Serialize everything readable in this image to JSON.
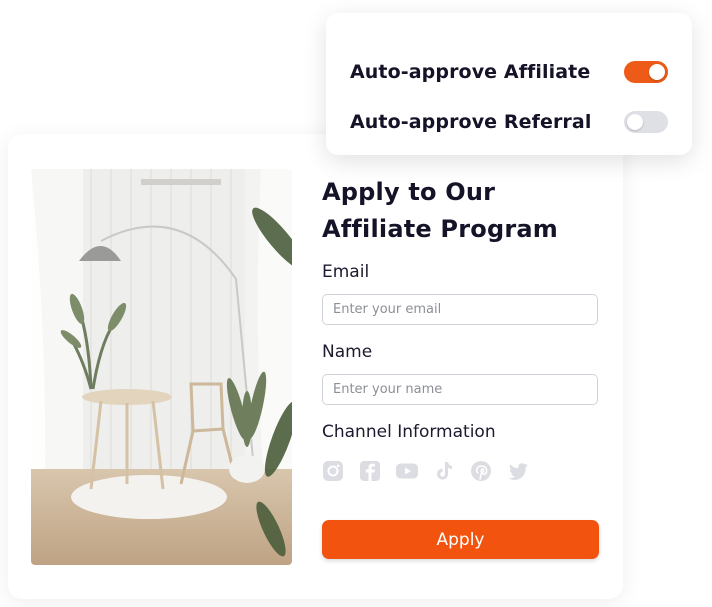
{
  "settings": {
    "auto_approve_affiliate": {
      "label": "Auto-approve Affiliate",
      "enabled": true
    },
    "auto_approve_referral": {
      "label": "Auto-approve Referral",
      "enabled": false
    }
  },
  "form": {
    "title": "Apply to Our Affiliate Program",
    "email_label": "Email",
    "email_placeholder": "Enter your email",
    "name_label": "Name",
    "name_placeholder": "Enter your name",
    "channel_label": "Channel Information",
    "channels": [
      "instagram-icon",
      "facebook-icon",
      "youtube-icon",
      "tiktok-icon",
      "pinterest-icon",
      "twitter-icon"
    ],
    "apply_label": "Apply"
  },
  "colors": {
    "accent": "#f25410",
    "toggle_on": "#ee5a17",
    "toggle_off": "#dfe0e6",
    "icon_gray": "#dcdde2"
  }
}
